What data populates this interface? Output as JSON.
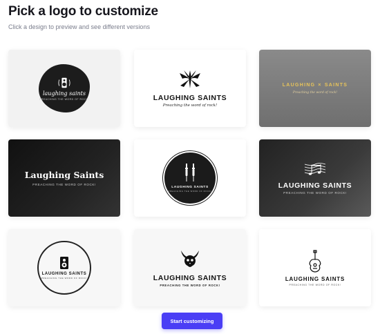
{
  "header": {
    "title": "Pick a logo to customize",
    "subtitle": "Click a design to preview and see different versions"
  },
  "brand": {
    "name_regular": "Laughing Saints",
    "name_lower": "laughing saints",
    "name_upper": "LAUGHING SAINTS",
    "name_split_left": "LAUGHING",
    "name_split_sep": "×",
    "name_split_right": "SAINTS",
    "tagline_script": "Preaching the word of rock!",
    "tagline_upper": "PREACHING THE WORD OF ROCK!",
    "tagline_title": "PREACHING THE WORD OF ROCK!",
    "tagline_spaced": "PREACHING THE WORD OF ROCK!"
  },
  "logos": [
    {
      "id": 1,
      "icon": "speaker-icon",
      "background": "#f2f2f2"
    },
    {
      "id": 2,
      "icon": "tribal-symbol-icon",
      "background": "#ffffff"
    },
    {
      "id": 3,
      "icon": "none",
      "background": "#7c7c7c"
    },
    {
      "id": 4,
      "icon": "none",
      "background": "#1a1a1a"
    },
    {
      "id": 5,
      "icon": "audio-jack-icon",
      "background": "#ffffff"
    },
    {
      "id": 6,
      "icon": "sheet-music-icon",
      "background": "#3a3a3a"
    },
    {
      "id": 7,
      "icon": "speaker-icon",
      "background": "#f7f7f7"
    },
    {
      "id": 8,
      "icon": "skull-horns-icon",
      "background": "#f7f7f7"
    },
    {
      "id": 9,
      "icon": "guitar-icon",
      "background": "#ffffff"
    }
  ],
  "actions": {
    "start_label": "Start customizing"
  },
  "colors": {
    "accent": "#4a3ef5",
    "gold": "#e8c45a"
  }
}
